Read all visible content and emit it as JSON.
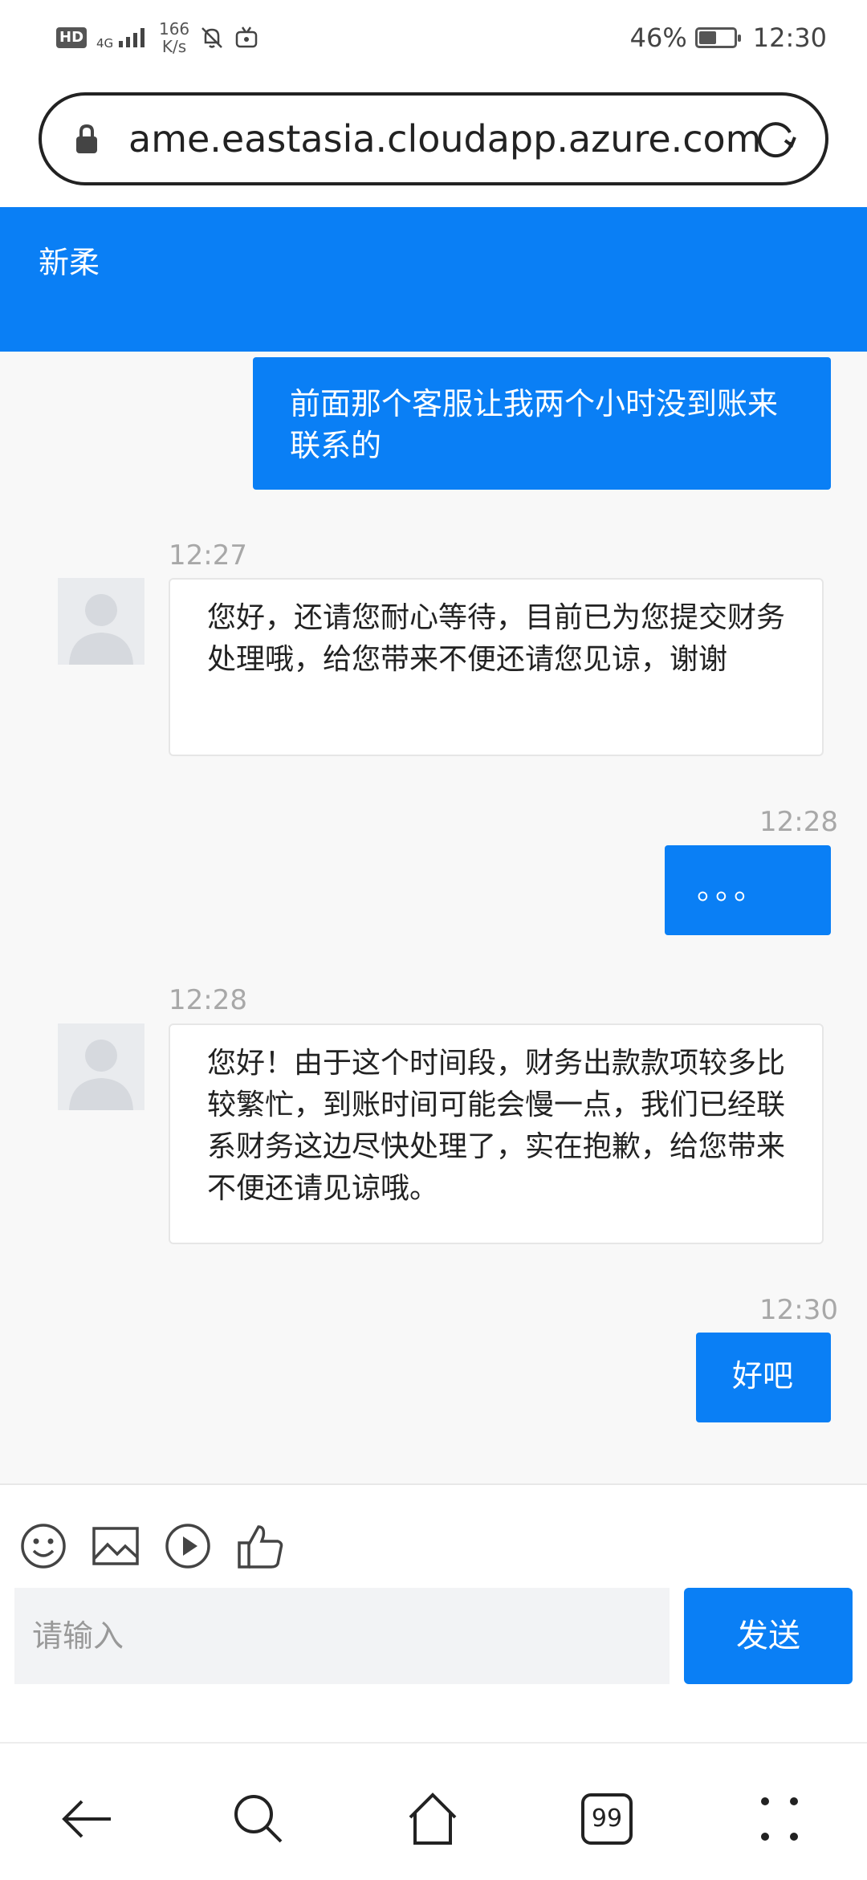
{
  "status_bar": {
    "hd": "HD",
    "network": "4G",
    "speed_value": "166",
    "speed_unit": "K/s",
    "battery": "46%",
    "battery_level": 0.46,
    "time": "12:30"
  },
  "browser": {
    "url": "ame.eastasia.cloudapp.azure.com"
  },
  "chat": {
    "title": "新柔",
    "messages": [
      {
        "from": "me",
        "text": "前面那个客服让我两个小时没到账来联系的"
      },
      {
        "from": "agent",
        "time": "12:27",
        "text": "您好，还请您耐心等待，目前已为您提交财务处理哦，给您带来不便还请您见谅，谢谢"
      },
      {
        "from": "me",
        "time": "12:28",
        "text": "。。。"
      },
      {
        "from": "agent",
        "time": "12:28",
        "text": "您好！由于这个时间段，财务出款款项较多比较繁忙，到账时间可能会慢一点，我们已经联系财务这边尽快处理了，实在抱歉，给您带来不便还请见谅哦。"
      },
      {
        "from": "me",
        "time": "12:30",
        "text": "好吧"
      }
    ]
  },
  "composer": {
    "placeholder": "请输入",
    "send_label": "发送",
    "tools": [
      "emoji-icon",
      "image-icon",
      "video-icon",
      "thumbs-up-icon"
    ]
  },
  "nav": {
    "tabs_count": "99",
    "icons": [
      "back-icon",
      "search-icon",
      "home-icon",
      "tabs-icon",
      "more-icon"
    ]
  },
  "colors": {
    "accent": "#0a7ff5"
  }
}
